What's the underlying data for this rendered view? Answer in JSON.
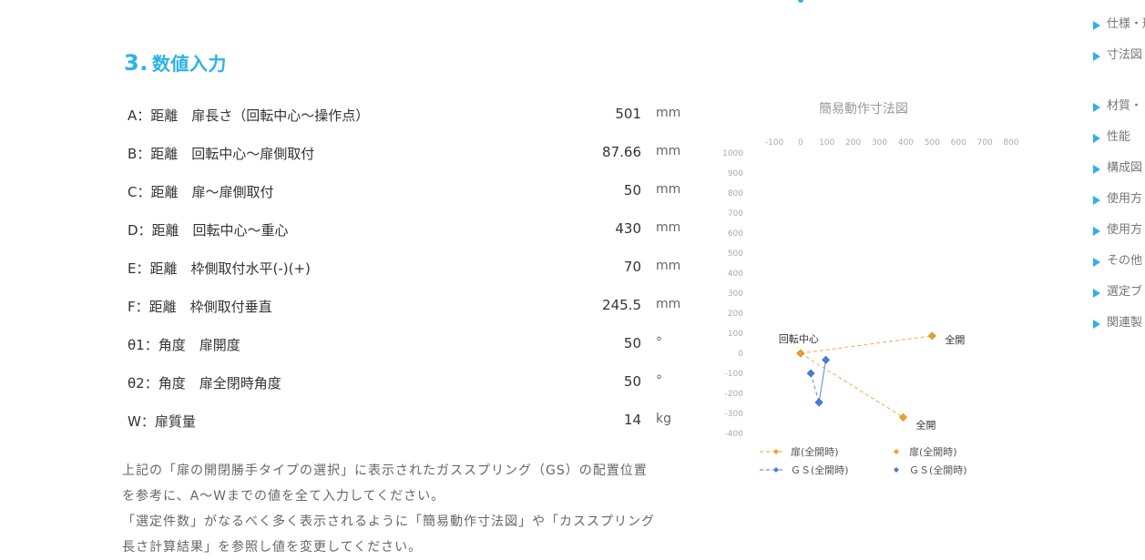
{
  "section": {
    "number": "3.",
    "title": "数値入力"
  },
  "inputs": [
    {
      "label": "A：距離　扉長さ（回転中心～操作点）",
      "value": "501",
      "unit": "mm"
    },
    {
      "label": "B：距離　回転中心～扉側取付",
      "value": "87.66",
      "unit": "mm"
    },
    {
      "label": "C：距離　扉～扉側取付",
      "value": "50",
      "unit": "mm"
    },
    {
      "label": "D：距離　回転中心～重心",
      "value": "430",
      "unit": "mm"
    },
    {
      "label": "E：距離　枠側取付水平(-)(+)",
      "value": "70",
      "unit": "mm"
    },
    {
      "label": "F：距離　枠側取付垂直",
      "value": "245.5",
      "unit": "mm"
    },
    {
      "label": "θ1：角度　扉開度",
      "value": "50",
      "unit": "°"
    },
    {
      "label": "θ2：角度　扉全閉時角度",
      "value": "50",
      "unit": "°"
    },
    {
      "label": "W：扉質量",
      "value": "14",
      "unit": "kg"
    }
  ],
  "notes": [
    "上記の「扉の開閉勝手タイプの選択」に表示されたガススプリング（GS）の配置位置",
    "を参考に、A～Wまでの値を全て入力してください。",
    "「選定件数」がなるべく多く表示されるように「簡易動作寸法図」や「カススプリング",
    "長さ計算結果」を参照し値を変更してください。"
  ],
  "chart_data": {
    "type": "scatter",
    "title": "簡易動作寸法図",
    "x_ticks": [
      "-100",
      "0",
      "100",
      "200",
      "300",
      "400",
      "500",
      "600",
      "700",
      "800"
    ],
    "y_ticks": [
      "1000",
      "900",
      "800",
      "700",
      "600",
      "500",
      "400",
      "300",
      "200",
      "100",
      "0",
      "-100",
      "-200",
      "-300",
      "-400"
    ],
    "xlim": [
      -100,
      800
    ],
    "ylim": [
      -400,
      1000
    ],
    "series": [
      {
        "name": "扉(全開時)",
        "color": "#f0a030",
        "dashed": true,
        "points": [
          [
            0,
            0
          ],
          [
            500,
            87
          ]
        ]
      },
      {
        "name": "扉(全開時)",
        "color": "#f0a030",
        "dashed": true,
        "points": [
          [
            0,
            0
          ],
          [
            390,
            -320
          ]
        ]
      },
      {
        "name": "ＧＳ(全開時)",
        "color": "#4a7fd4",
        "dashed": true,
        "points": [
          [
            39,
            -100
          ],
          [
            70,
            -245
          ]
        ]
      },
      {
        "name": "ＧＳ(全開時)",
        "color": "#4a7fd4",
        "dashed": false,
        "points": [
          [
            96,
            -33
          ],
          [
            70,
            -245
          ]
        ]
      }
    ],
    "annotations": [
      {
        "text": "回転中心",
        "x": 0,
        "y": 0
      },
      {
        "text": "全開",
        "x": 500,
        "y": 87
      },
      {
        "text": "全開",
        "x": 390,
        "y": -320
      }
    ],
    "legend_position": "bottom"
  },
  "sidebar": [
    "仕様・形",
    "寸法図・GSF",
    "材質・",
    "性能",
    "構成図",
    "使用方",
    "使用方",
    "その他",
    "選定ブ",
    "関連製"
  ]
}
